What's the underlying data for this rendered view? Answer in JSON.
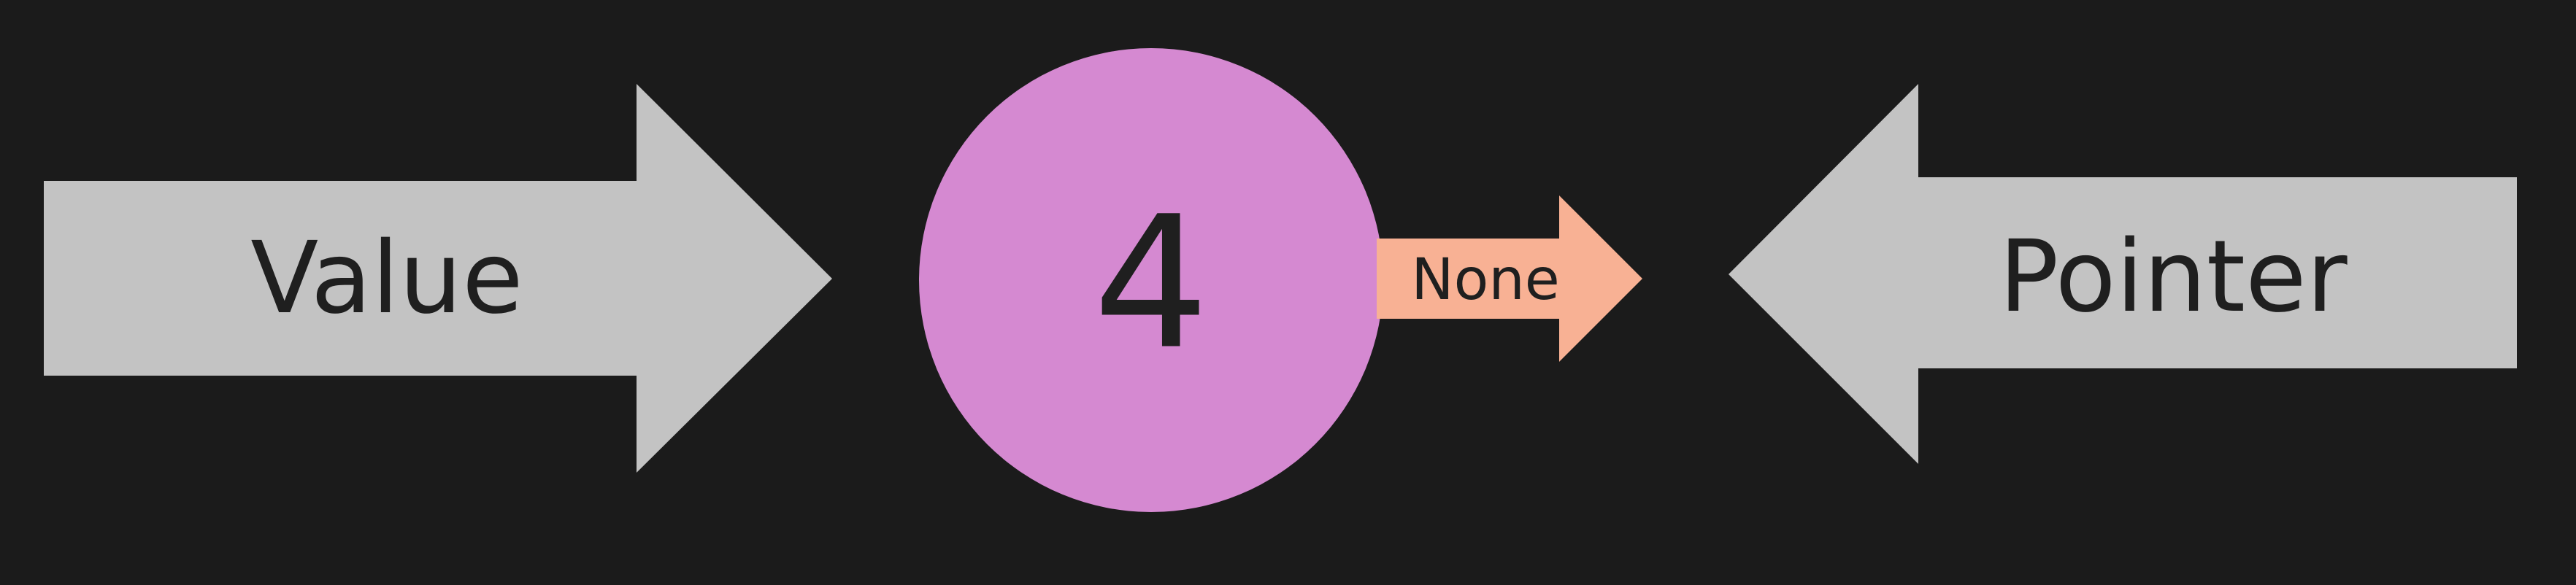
{
  "diagram": {
    "left_arrow": {
      "label": "Value",
      "direction": "right"
    },
    "node": {
      "value": "4"
    },
    "next_arrow": {
      "label": "None",
      "direction": "right"
    },
    "right_arrow": {
      "label": "Pointer",
      "direction": "left"
    }
  },
  "colors": {
    "background": "#1b1b1b",
    "arrow_fill": "#c3c3c3",
    "node_fill": "#d589d1",
    "next_arrow_fill": "#f8b194",
    "text": "#1f1f1f"
  }
}
